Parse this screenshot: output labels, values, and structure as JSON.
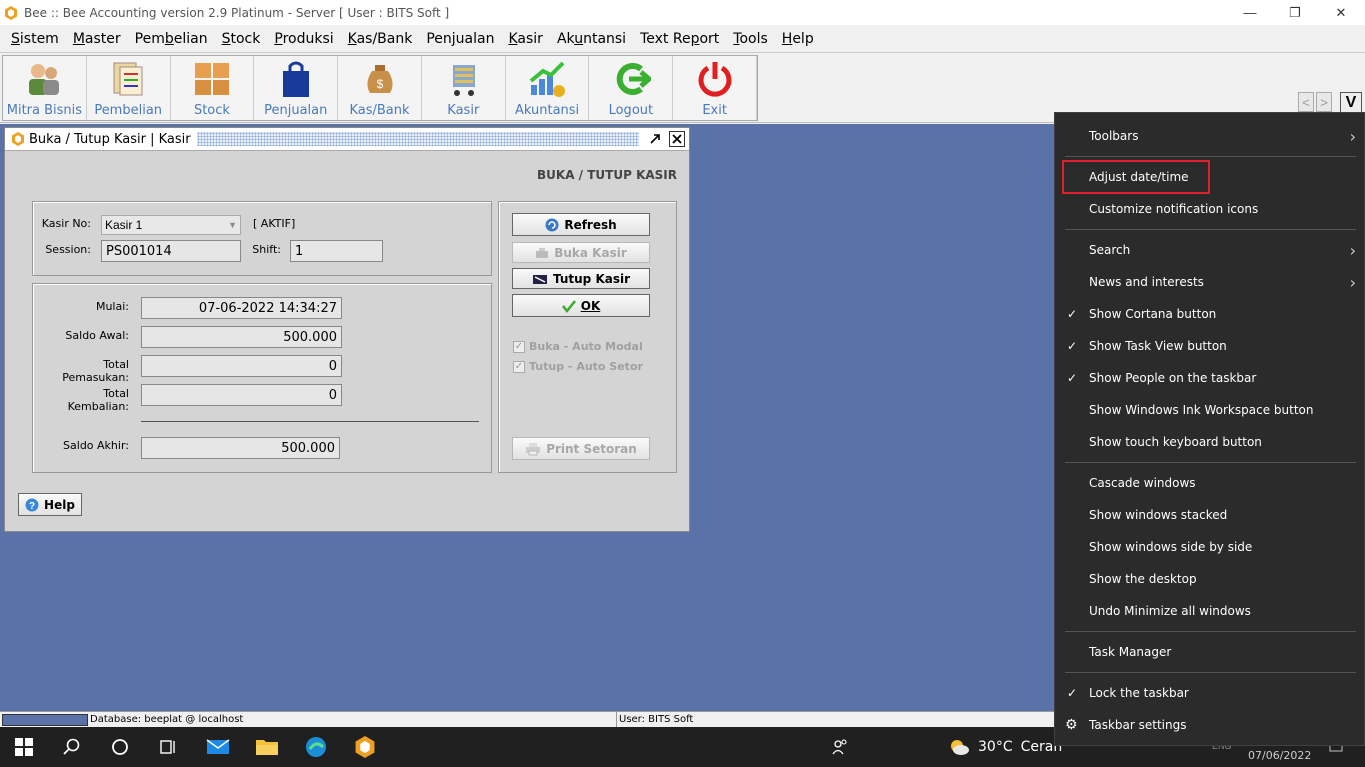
{
  "window": {
    "title": "Bee :: Bee Accounting version 2.9 Platinum - Server  [ User : BITS Soft ]",
    "minimize": "—",
    "restore": "❐",
    "close": "✕"
  },
  "menubar": [
    {
      "pre": "",
      "u": "S",
      "post": "istem"
    },
    {
      "pre": "",
      "u": "M",
      "post": "aster"
    },
    {
      "pre": "Pem",
      "u": "b",
      "post": "elian"
    },
    {
      "pre": "",
      "u": "S",
      "post": "tock"
    },
    {
      "pre": "",
      "u": "P",
      "post": "roduksi"
    },
    {
      "pre": "",
      "u": "K",
      "post": "as/Bank"
    },
    {
      "pre": "Pen",
      "u": "j",
      "post": "ualan"
    },
    {
      "pre": "",
      "u": "K",
      "post": "asir"
    },
    {
      "pre": "Ak",
      "u": "u",
      "post": "ntansi"
    },
    {
      "pre": "Text Re",
      "u": "p",
      "post": "ort"
    },
    {
      "pre": "",
      "u": "T",
      "post": "ools"
    },
    {
      "pre": "",
      "u": "H",
      "post": "elp"
    }
  ],
  "toolbar": [
    {
      "label": "Mitra Bisnis",
      "icon": "people-icon"
    },
    {
      "label": "Pembelian",
      "icon": "documents-icon"
    },
    {
      "label": "Stock",
      "icon": "boxes-icon"
    },
    {
      "label": "Penjualan",
      "icon": "shopping-bag-icon"
    },
    {
      "label": "Kas/Bank",
      "icon": "money-bag-icon"
    },
    {
      "label": "Kasir",
      "icon": "cart-icon"
    },
    {
      "label": "Akuntansi",
      "icon": "growth-chart-icon"
    },
    {
      "label": "Logout",
      "icon": "logout-arrow-icon"
    },
    {
      "label": "Exit",
      "icon": "power-icon"
    }
  ],
  "toolbar_nav": {
    "prev": "<",
    "next": ">",
    "v": "V"
  },
  "child": {
    "title": "Buka / Tutup Kasir | Kasir",
    "header": "BUKA / TUTUP KASIR",
    "kasir_no_label": "Kasir No:",
    "kasir_no_value": "Kasir 1",
    "status": "[ AKTIF]",
    "session_label": "Session:",
    "session_value": "PS001014",
    "shift_label": "Shift:",
    "shift_value": "1",
    "mulai_label": "Mulai:",
    "mulai_value": "07-06-2022 14:34:27",
    "saldo_awal_label": "Saldo Awal:",
    "saldo_awal_value": "500.000",
    "total_pemasukan_label": "Total Pemasukan:",
    "total_pemasukan_value": "0",
    "total_kembalian_label": "Total Kembalian:",
    "total_kembalian_value": "0",
    "saldo_akhir_label": "Saldo Akhir:",
    "saldo_akhir_value": "500.000",
    "btn_refresh": "Refresh",
    "btn_buka": "Buka Kasir",
    "btn_tutup": "Tutup Kasir",
    "btn_ok": "OK",
    "chk_buka": "Buka - Auto Modal",
    "chk_tutup": "Tutup - Auto Setor",
    "btn_print": "Print Setoran",
    "btn_help": "Help"
  },
  "statusbar": {
    "database": "Database: beeplat @ localhost",
    "user": "User: BITS Soft"
  },
  "taskbar": {
    "temperature": "30°C",
    "weather": "Cerah",
    "date": "07/06/2022",
    "lang": "ENG"
  },
  "context_menu": {
    "items": [
      {
        "label": "Toolbars",
        "submenu": true
      },
      {
        "label": "Adjust date/time"
      },
      {
        "label": "Customize notification icons"
      },
      {
        "label": "Search",
        "submenu": true
      },
      {
        "label": "News and interests",
        "submenu": true
      },
      {
        "label": "Show Cortana button",
        "checked": true
      },
      {
        "label": "Show Task View button",
        "checked": true
      },
      {
        "label": "Show People on the taskbar",
        "checked": true
      },
      {
        "label": "Show Windows Ink Workspace button"
      },
      {
        "label": "Show touch keyboard button"
      },
      {
        "label": "Cascade windows"
      },
      {
        "label": "Show windows stacked"
      },
      {
        "label": "Show windows side by side"
      },
      {
        "label": "Show the desktop"
      },
      {
        "label": "Undo Minimize all windows"
      },
      {
        "label": "Task Manager"
      },
      {
        "label": "Lock the taskbar",
        "checked": true
      },
      {
        "label": "Taskbar settings",
        "gear": true
      }
    ],
    "highlight_color": "#e0202a"
  }
}
